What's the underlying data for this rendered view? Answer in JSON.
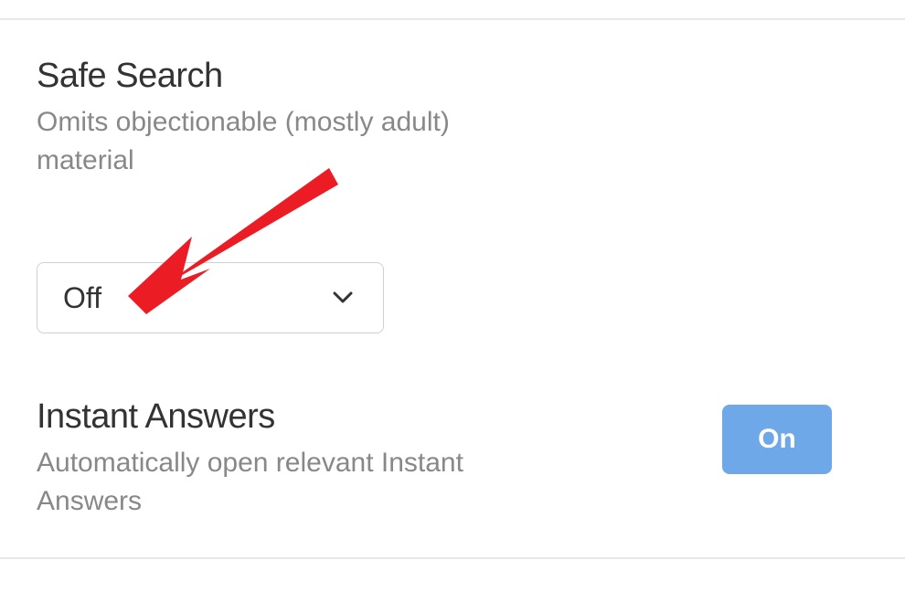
{
  "colors": {
    "accent": "#6fa8e8",
    "annotation": "#ec1c24"
  },
  "settings": [
    {
      "title": "Safe Search",
      "description": "Omits objectionable (mostly adult) material",
      "control_type": "dropdown",
      "value": "Off"
    },
    {
      "title": "Instant Answers",
      "description": "Automatically open relevant Instant Answers",
      "control_type": "toggle",
      "value": "On"
    }
  ],
  "annotations": {
    "arrow": "red-arrow-pointing-to-dropdown"
  }
}
